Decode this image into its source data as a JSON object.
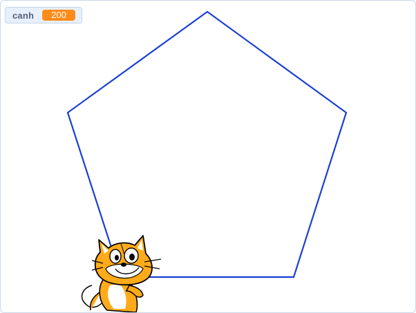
{
  "stage": {
    "variable_monitor": {
      "label": "canh",
      "value": "200",
      "value_color": "#ff8c1a"
    },
    "pen_color": "#1a3fd1",
    "sprite": {
      "icon": "scratch-cat-icon"
    }
  }
}
